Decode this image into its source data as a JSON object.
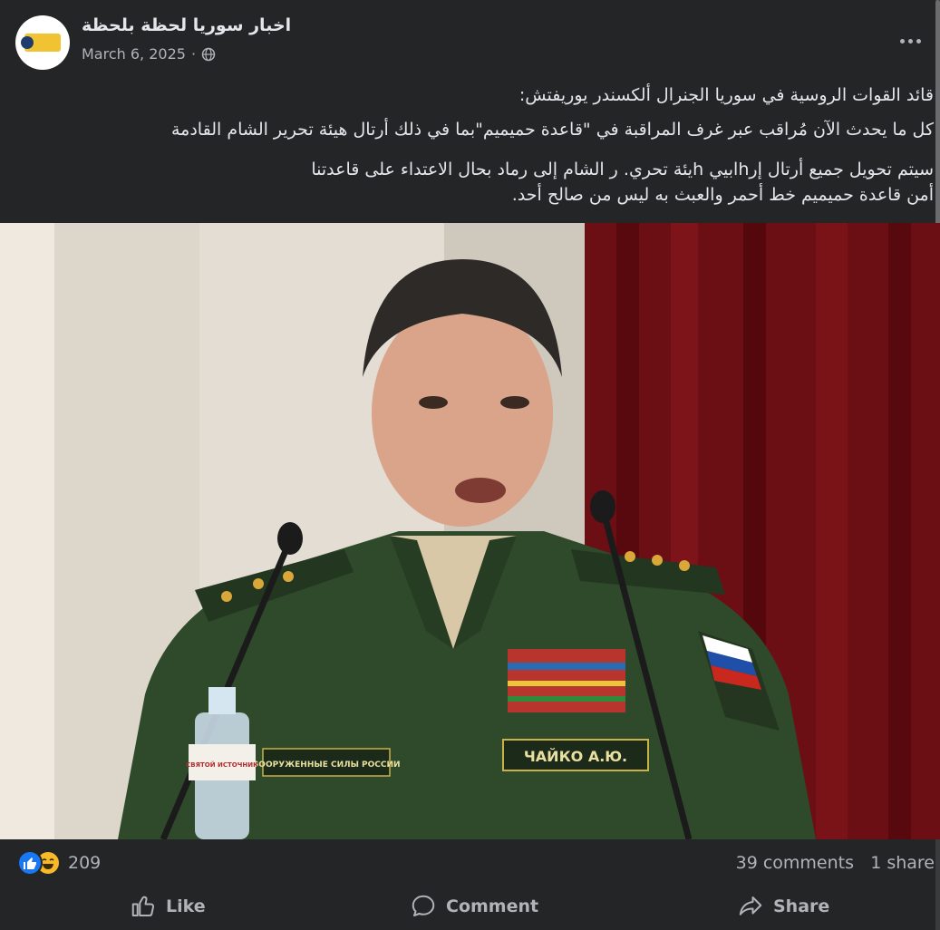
{
  "post": {
    "page_name": "اخبار سوريا لحظة بلحظة",
    "date": "March 6, 2025",
    "separator": "·",
    "text_lines": [
      "قائد القوات الروسية في سوريا الجنرال ألكسندر يوريفتش:",
      "كل ما يحدث الآن مُراقب عبر غرف المراقبة في \"قاعدة حميميم\"بما في ذلك أرتال هيئة تحرير الشام القادمة",
      "سيتم تحويل جميع أرتال إرhابيي hيئة تحري. ر الشام إلى رماد بحال الاعتداء على قاعدتنا",
      "أمن قاعدة حميميم خط أحمر والعبث به ليس من صالح أحد."
    ],
    "photo": {
      "nametag": "ЧАЙКО А.Ю.",
      "chest_patch": "ВООРУЖЕННЫЕ СИЛЫ РОССИИ",
      "bottle_label": "СВЯТОЙ ИСТОЧНИК"
    }
  },
  "stats": {
    "reaction_count": "209",
    "comments": "39 comments",
    "shares": "1 share"
  },
  "actions": {
    "like": "Like",
    "comment": "Comment",
    "share": "Share"
  },
  "colors": {
    "background": "#242526",
    "text": "#e4e6eb",
    "secondary": "#b0b3b8",
    "like_blue": "#1877f2",
    "haha_yellow": "#f7b928"
  }
}
